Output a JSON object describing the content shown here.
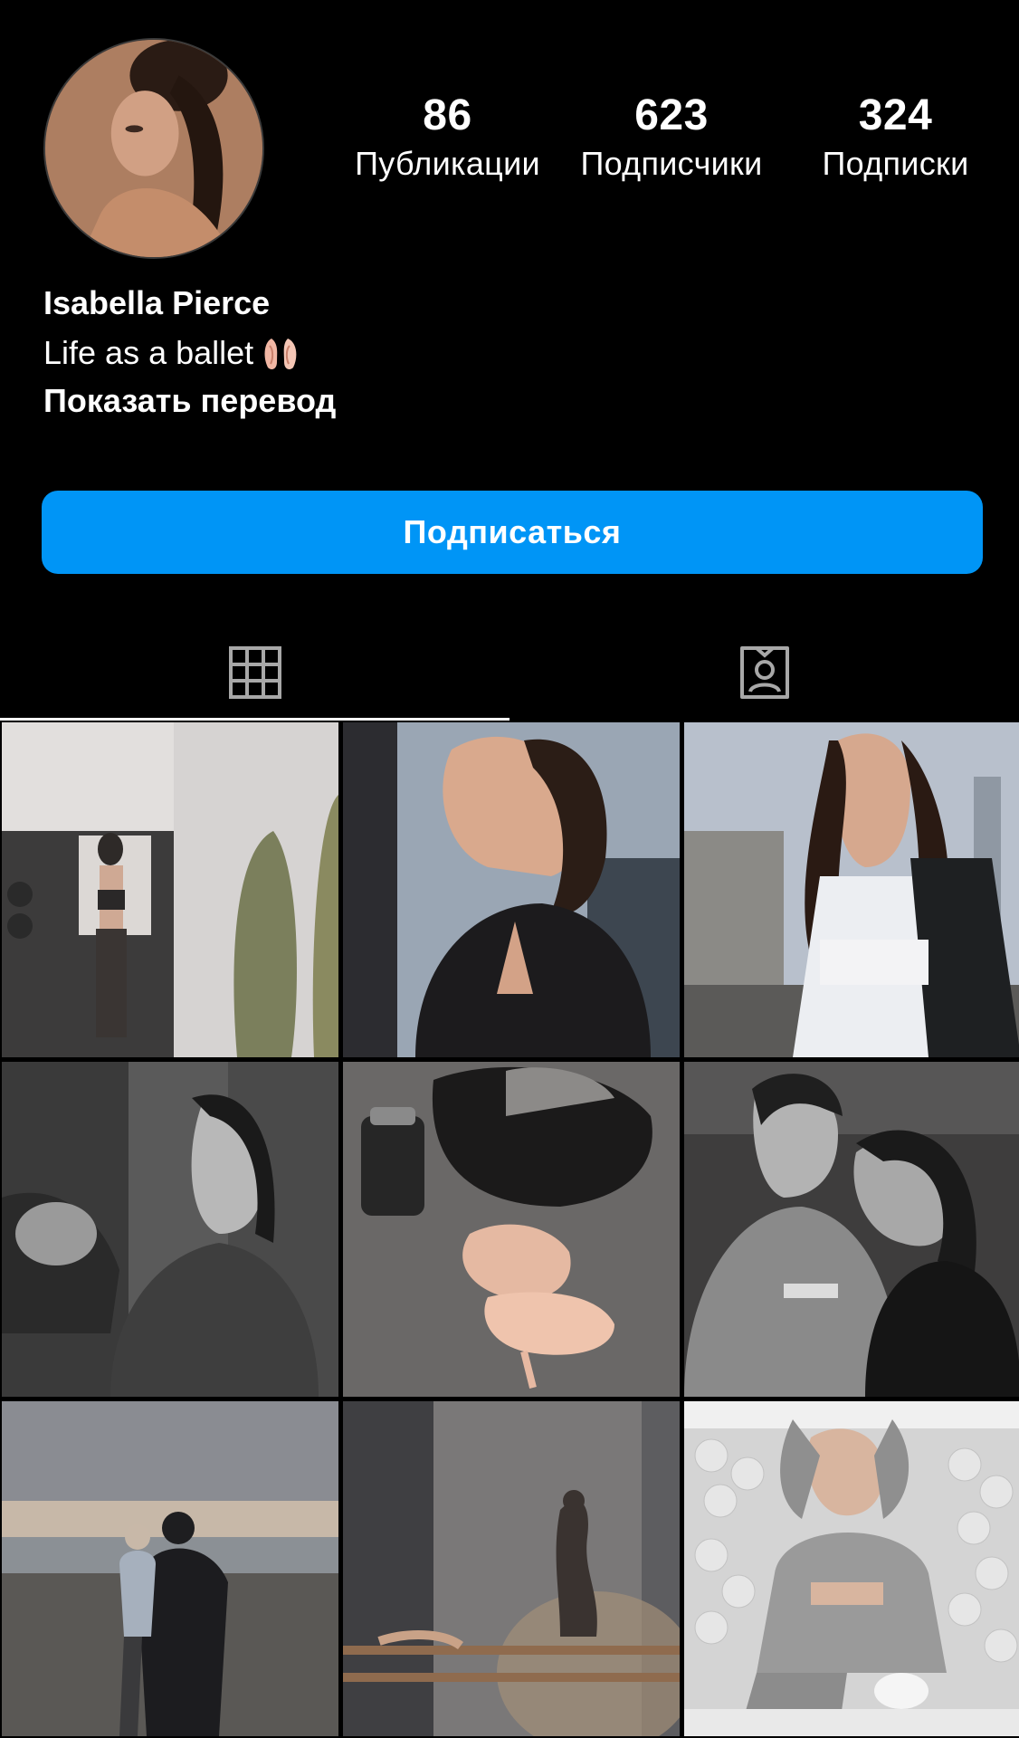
{
  "profile": {
    "avatar_icon": "profile-photo",
    "name": "Isabella Pierce",
    "bio": "Life as a ballet",
    "bio_emoji": "ballet-shoes-icon",
    "translate_label": "Показать перевод"
  },
  "stats": [
    {
      "value": "86",
      "label": "Публикации"
    },
    {
      "value": "623",
      "label": "Подписчики"
    },
    {
      "value": "324",
      "label": "Подписки"
    }
  ],
  "actions": {
    "follow_label": "Подписаться",
    "follow_color": "#0095f6"
  },
  "tabs": [
    {
      "icon": "grid-icon",
      "active": true
    },
    {
      "icon": "tagged-icon",
      "active": false
    }
  ],
  "posts": [
    {
      "id": 1,
      "subject": "gym mirror selfie"
    },
    {
      "id": 2,
      "subject": "portrait in black top"
    },
    {
      "id": 3,
      "subject": "woman on rooftop"
    },
    {
      "id": 4,
      "subject": "black and white portrait"
    },
    {
      "id": 5,
      "subject": "ballet shoes and bag"
    },
    {
      "id": 6,
      "subject": "couple portrait"
    },
    {
      "id": 7,
      "subject": "beach at sunset"
    },
    {
      "id": 8,
      "subject": "ballet barre shadow"
    },
    {
      "id": 9,
      "subject": "ball pit"
    }
  ]
}
